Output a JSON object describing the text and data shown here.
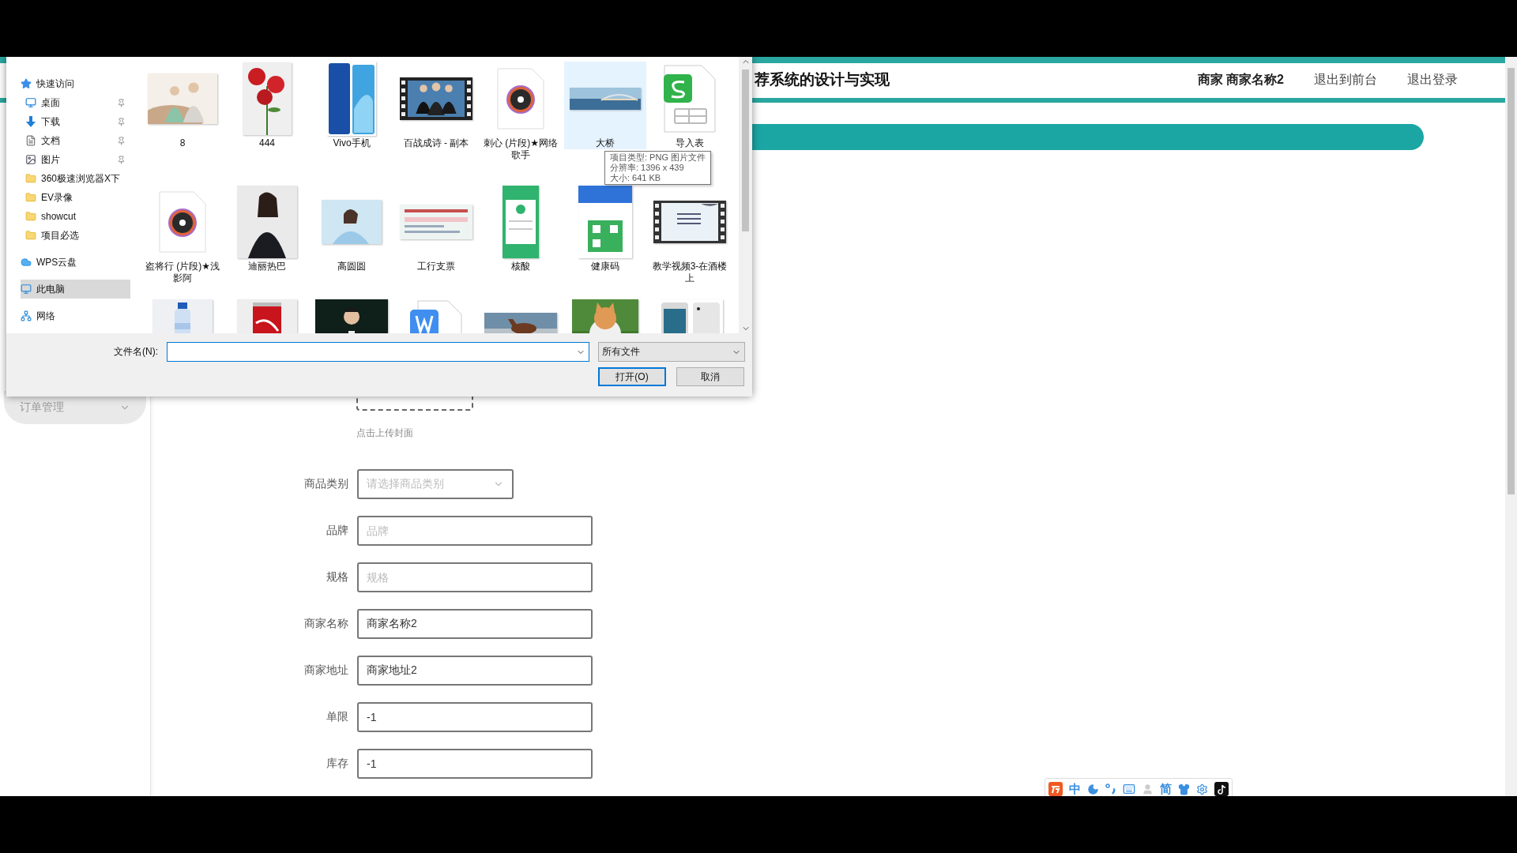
{
  "page": {
    "title": "荐系统的设计与实现",
    "nav": [
      {
        "label": "商家 商家名称2",
        "kind": "user"
      },
      {
        "label": "退出到前台",
        "kind": "link"
      },
      {
        "label": "退出登录",
        "kind": "link"
      }
    ]
  },
  "sidebar": {
    "items": [
      {
        "label": "订单管理",
        "expanded": false
      }
    ]
  },
  "form": {
    "upload_hint": "点击上传封面",
    "fields": [
      {
        "label": "商品类别",
        "kind": "select",
        "placeholder": "请选择商品类别"
      },
      {
        "label": "品牌",
        "kind": "text",
        "placeholder": "品牌"
      },
      {
        "label": "规格",
        "kind": "text",
        "placeholder": "规格"
      },
      {
        "label": "商家名称",
        "kind": "text",
        "value": "商家名称2"
      },
      {
        "label": "商家地址",
        "kind": "text",
        "value": "商家地址2"
      },
      {
        "label": "单限",
        "kind": "text",
        "value": "-1"
      },
      {
        "label": "库存",
        "kind": "text",
        "value": "-1"
      }
    ]
  },
  "dialog": {
    "nav": [
      {
        "label": "快速访问",
        "kind": "star",
        "selected": false,
        "children": [
          {
            "label": "桌面",
            "kind": "desktop",
            "selected": false,
            "pinned": true
          },
          {
            "label": "下载",
            "kind": "download",
            "selected": false,
            "pinned": true
          },
          {
            "label": "文档",
            "kind": "docs",
            "selected": false,
            "pinned": true
          },
          {
            "label": "图片",
            "kind": "pictures",
            "selected": false,
            "pinned": true
          },
          {
            "label": "360极速浏览器X下",
            "kind": "folder",
            "selected": false,
            "pinned": false
          },
          {
            "label": "EV录像",
            "kind": "folder",
            "selected": false,
            "pinned": false
          },
          {
            "label": "showcut",
            "kind": "folder",
            "selected": false,
            "pinned": false
          },
          {
            "label": "项目必选",
            "kind": "folder",
            "selected": false,
            "pinned": false
          }
        ]
      },
      {
        "label": "WPS云盘",
        "kind": "cloud",
        "selected": false
      },
      {
        "label": "此电脑",
        "kind": "pc",
        "selected": true
      },
      {
        "label": "网络",
        "kind": "network",
        "selected": false
      }
    ],
    "files": [
      {
        "label": "8",
        "kind": "picture",
        "selected": false
      },
      {
        "label": "444",
        "kind": "picture",
        "selected": false
      },
      {
        "label": "Vivo手机",
        "kind": "picture",
        "selected": false
      },
      {
        "label": "百战成诗 - 副本",
        "kind": "video",
        "selected": false
      },
      {
        "label": "刺心 (片段)★网络歌手",
        "kind": "music",
        "selected": false
      },
      {
        "label": "大桥",
        "kind": "picture",
        "selected": true
      },
      {
        "label": "导入表",
        "kind": "sheet",
        "selected": false
      },
      {
        "label": "盗将行 (片段)★浅影阿",
        "kind": "music",
        "selected": false
      },
      {
        "label": "迪丽热巴",
        "kind": "picture",
        "selected": false
      },
      {
        "label": "高圆圆",
        "kind": "picture",
        "selected": false
      },
      {
        "label": "工行支票",
        "kind": "picture",
        "selected": false
      },
      {
        "label": "核酸",
        "kind": "picture",
        "selected": false
      },
      {
        "label": "健康码",
        "kind": "picture",
        "selected": false
      },
      {
        "label": "教学视频3-在酒楼上",
        "kind": "video",
        "selected": false
      },
      {
        "kind": "picture",
        "selected": false
      },
      {
        "kind": "picture",
        "selected": false
      },
      {
        "kind": "picture",
        "selected": false
      },
      {
        "kind": "doc",
        "selected": false
      },
      {
        "kind": "picture",
        "selected": false
      },
      {
        "kind": "picture",
        "selected": false
      },
      {
        "kind": "picture",
        "selected": false
      }
    ],
    "tooltip": [
      "项目类型: PNG 图片文件",
      "分辨率: 1396 x 439",
      "大小: 641 KB"
    ],
    "filename_label": "文件名(N):",
    "filter": "所有文件",
    "buttons": [
      {
        "label": "打开(O)",
        "default": true
      },
      {
        "label": "取消",
        "default": false
      }
    ]
  },
  "ime": {
    "mode": "中",
    "script": "简"
  }
}
